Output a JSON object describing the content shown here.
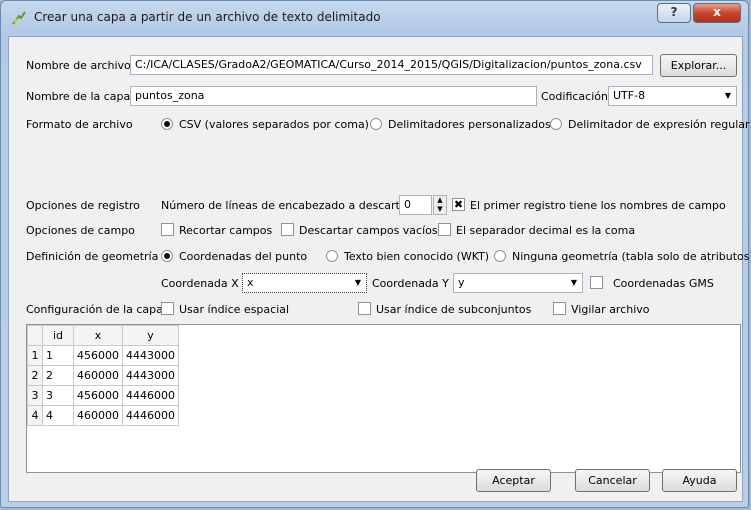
{
  "window": {
    "title": "Crear una capa a partir de un archivo de texto delimitado",
    "help_glyph": "?",
    "close_glyph": "x"
  },
  "file": {
    "label": "Nombre de archivo",
    "value": "C:/ICA/CLASES/GradoA2/GEOMATICA/Curso_2014_2015/QGIS/Digitalizacion/puntos_zona.csv",
    "browse_label": "Explorar..."
  },
  "layer": {
    "label": "Nombre de la capa",
    "value": "puntos_zona",
    "encoding_label": "Codificación",
    "encoding_value": "UTF-8"
  },
  "format": {
    "label": "Formato de archivo",
    "options": [
      "CSV (valores separados por coma)",
      "Delimitadores personalizados",
      "Delimitador de expresión regular"
    ],
    "selected": 0
  },
  "records": {
    "label": "Opciones de registro",
    "header_lines_label": "Número de líneas de encabezado a descartar",
    "header_lines_value": "0",
    "first_record_label": "El primer registro tiene los nombres de campo",
    "first_record_checked": true
  },
  "fields": {
    "label": "Opciones de campo",
    "trim_label": "Recortar campos",
    "discard_empty_label": "Descartar campos vacíos",
    "decimal_comma_label": "El separador decimal es la coma"
  },
  "geometry": {
    "label": "Definición de geometría",
    "options": [
      "Coordenadas del punto",
      "Texto bien conocido (WKT)",
      "Ninguna geometría (tabla solo de atributos)"
    ],
    "selected": 0,
    "x_label": "Coordenada X",
    "x_value": "x",
    "y_label": "Coordenada Y",
    "y_value": "y",
    "dms_label": "Coordenadas GMS"
  },
  "layer_settings": {
    "label": "Configuración de la capa",
    "spatial_index_label": "Usar índice espacial",
    "subset_index_label": "Usar índice de subconjuntos",
    "watch_file_label": "Vigilar archivo"
  },
  "preview": {
    "columns": [
      "id",
      "x",
      "y"
    ],
    "rows": [
      {
        "n": "1",
        "id": "1",
        "x": "456000",
        "y": "4443000"
      },
      {
        "n": "2",
        "id": "2",
        "x": "460000",
        "y": "4443000"
      },
      {
        "n": "3",
        "id": "3",
        "x": "456000",
        "y": "4446000"
      },
      {
        "n": "4",
        "id": "4",
        "x": "460000",
        "y": "4446000"
      }
    ]
  },
  "buttons": {
    "ok": "Aceptar",
    "cancel": "Cancelar",
    "help": "Ayuda"
  },
  "icons": {
    "app": "qgis-delimited-text-icon",
    "help": "help-icon",
    "close": "close-icon",
    "check": "check-mark-icon"
  },
  "colors": {
    "close_button": "#c8452c",
    "title_gradient": "#b3cbe6"
  }
}
